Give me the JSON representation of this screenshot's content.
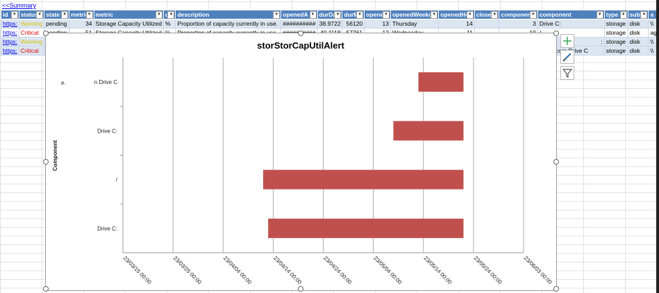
{
  "summary_link": "<<Summary",
  "table": {
    "headers": [
      "id",
      "status",
      "state",
      "metric",
      "metric",
      "ui",
      "description",
      "openedA",
      "durDa",
      "durM",
      "openeD",
      "openedWeekd",
      "openedHo",
      "closed",
      "component",
      "component",
      "type",
      "subty",
      "a"
    ],
    "rows": [
      {
        "id": "https:",
        "status": "Warning",
        "state": "pending",
        "metric_num": "34",
        "metric": "Storage Capacity Utilized",
        "unit": "%",
        "description": "Proportion of capacity currently in use.",
        "openedA": "##########",
        "durDa": "38.9722",
        "durM": "56120",
        "openeD": "13",
        "weekday": "Thursday",
        "openedHo": "14",
        "closed": "",
        "component_num": "3",
        "component": "Drive C:",
        "type": "storage",
        "subtype": "disk",
        "a": "\\\\"
      },
      {
        "id": "https:",
        "status": "Critical",
        "state": "pending",
        "metric_num": "51",
        "metric": "Storage Capacity Utilized",
        "unit": "%",
        "description": "Proportion of capacity currently in use.",
        "openedA": "##########",
        "durDa": "40.1118",
        "durM": "57761",
        "openeD": "12",
        "weekday": "Wednesday",
        "openedHo": "11",
        "closed": "",
        "component_num": "10",
        "component": "/",
        "type": "storage",
        "subtype": "disk",
        "a": "ag"
      },
      {
        "id": "https:",
        "status": "Warning",
        "state": "",
        "metric_num": "",
        "metric": "",
        "unit": "",
        "description": "",
        "openedA": "",
        "durDa": "",
        "durM": "",
        "openeD": "",
        "weekday": "",
        "openedHo": "",
        "closed": "",
        "component_num": "",
        "component": ":",
        "type": "storage",
        "subtype": "disk",
        "a": "\\\\"
      },
      {
        "id": "https:",
        "status": "Critical",
        "state": "",
        "metric_num": "",
        "metric": "",
        "unit": "",
        "description": "",
        "openedA": "",
        "durDa": "",
        "durM": "",
        "openeD": "",
        "weekday": "",
        "openedHo": "",
        "closed": "",
        "component_num": "",
        "component": "9.esri.com Drive C",
        "type": "storage",
        "subtype": "disk",
        "a": "\\\\"
      }
    ]
  },
  "colors": {
    "header": "#4f81bd",
    "band": "#dce6f1",
    "bar": "#c0504d",
    "warning": "#d4c000",
    "critical": "#e00000"
  },
  "icons": [
    "plus-icon",
    "brush-icon",
    "filter-icon"
  ],
  "chart_data": {
    "type": "bar",
    "orientation": "horizontal-gantt",
    "title": "storStorCapUtilAlert",
    "ylabel": "Component",
    "categories": [
      "Drive C:",
      "/",
      "Drive C:",
      "n Drive C"
    ],
    "extra_label": "e.",
    "x_ticks": [
      "23/03/15 00:00",
      "23/03/25 00:00",
      "23/04/04 00:00",
      "23/04/14 00:00",
      "23/04/24 00:00",
      "23/05/04 00:00",
      "23/05/14 00:00",
      "23/05/24 00:00",
      "23/06/03 00:00"
    ],
    "xlim": [
      "2023-03-15",
      "2023-06-03"
    ],
    "bars": [
      {
        "category": "Drive C:",
        "start": "2023-04-13",
        "end": "2023-05-22"
      },
      {
        "category": "/",
        "start": "2023-04-12",
        "end": "2023-05-22"
      },
      {
        "category": "Drive C:",
        "start": "2023-05-08",
        "end": "2023-05-22"
      },
      {
        "category": "n Drive C",
        "start": "2023-05-13",
        "end": "2023-05-22"
      }
    ]
  }
}
